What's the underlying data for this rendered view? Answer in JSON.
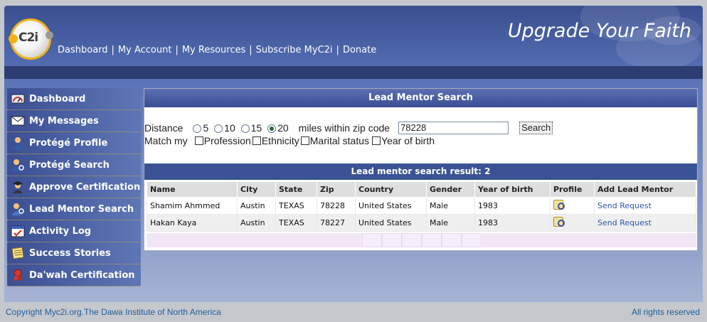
{
  "header": {
    "tagline": "Upgrade Your Faith",
    "logo_text": "C2i",
    "nav": [
      "Dashboard",
      "My Account",
      "My Resources",
      "Subscribe MyC2i",
      "Donate"
    ]
  },
  "sidebar": {
    "items": [
      {
        "label": "Dashboard",
        "icon": "gauge-icon"
      },
      {
        "label": "My Messages",
        "icon": "envelope-icon"
      },
      {
        "label": "Protégé Profile",
        "icon": "person-icon"
      },
      {
        "label": "Protégé Search",
        "icon": "person-search-icon"
      },
      {
        "label": "Approve Certification",
        "icon": "graduate-icon"
      },
      {
        "label": "Lead Mentor Search",
        "icon": "mentor-search-icon"
      },
      {
        "label": "Activity Log",
        "icon": "calendar-icon"
      },
      {
        "label": "Success Stories",
        "icon": "notebook-icon"
      },
      {
        "label": "Da'wah Certification",
        "icon": "award-ribbon-icon"
      }
    ]
  },
  "main": {
    "title": "Lead Mentor Search",
    "search": {
      "distance_label": "Distance",
      "distance_options": [
        "5",
        "10",
        "15",
        "20"
      ],
      "distance_selected": "20",
      "zip_label": "miles within zip code",
      "zip_value": "78228",
      "search_button": "Search",
      "match_label": "Match my",
      "match_options": [
        "Profession",
        "Ethnicity",
        "Marital status",
        "Year of birth"
      ]
    },
    "result_title": "Lead mentor search result: 2",
    "table": {
      "headers": [
        "Name",
        "City",
        "State",
        "Zip",
        "Country",
        "Gender",
        "Year of birth",
        "Profile",
        "Add Lead Mentor"
      ],
      "rows": [
        [
          "Shamim Ahmmed",
          "Austin",
          "TEXAS",
          "78228",
          "United States",
          "Male",
          "1983",
          "",
          "Send Request"
        ],
        [
          "Hakan Kaya",
          "Austin",
          "TEXAS",
          "78227",
          "United States",
          "Male",
          "1983",
          "",
          "Send Request"
        ]
      ]
    }
  },
  "footer": {
    "copyright": "Copyright Myc2i.org.The Dawa Institute of North America",
    "rights": "All rights reserved"
  },
  "colors": {
    "header_blue": "#3a4f8f",
    "link_blue": "#2a58a8",
    "result_bar": "#3b5394"
  }
}
